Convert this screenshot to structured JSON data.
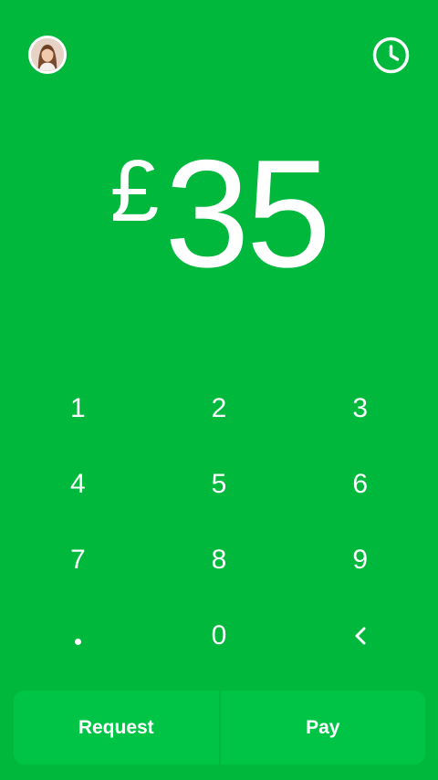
{
  "colors": {
    "background": "#00B93C",
    "button_background": "#00C446",
    "text": "#FFFFFF"
  },
  "header": {
    "avatar_icon": "profile-avatar",
    "history_icon": "clock-icon"
  },
  "amount": {
    "currency_symbol": "£",
    "value": "35"
  },
  "keypad": {
    "keys": [
      "1",
      "2",
      "3",
      "4",
      "5",
      "6",
      "7",
      "8",
      "9",
      "0"
    ],
    "decimal_icon": "dot",
    "backspace_icon": "chevron-left"
  },
  "actions": {
    "request_label": "Request",
    "pay_label": "Pay"
  }
}
